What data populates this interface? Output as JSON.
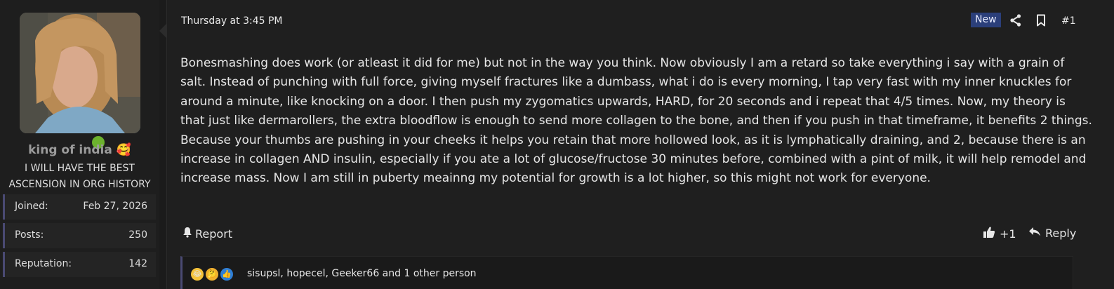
{
  "user": {
    "username": "king of india",
    "username_emoji": "🥰",
    "title_line1": "I WILL HAVE THE BEST",
    "title_line2": "ASCENSION IN ORG HISTORY",
    "online_color": "#6cb22d",
    "stats": [
      {
        "key": "Joined:",
        "value": "Feb 27, 2026"
      },
      {
        "key": "Posts:",
        "value": "250"
      },
      {
        "key": "Reputation:",
        "value": "142"
      }
    ]
  },
  "post": {
    "date": "Thursday at 3:45 PM",
    "badge": "New",
    "number": "#1",
    "body": "Bonesmashing does work (or atleast it did for me) but not in the way you think. Now obviously I am a retard so take everything i say with a grain of salt. Instead of punching with full force, giving myself fractures like a dumbass, what i do is every morning, I tap very fast with my inner knuckles for around a minute, like knocking on a door. I then push my zygomatics upwards, HARD, for 20 seconds and i repeat that 4/5 times. Now, my theory is that just like dermarollers, the extra bloodflow is enough to send more collagen to the bone, and then if you push in that timeframe, it benefits 2 things. Because your thumbs are pushing in your cheeks it helps you retain that more hollowed look, as it is lymphatically draining, and 2, because there is an increase in collagen AND insulin, especially if you ate a lot of glucose/fructose 30 minutes before, combined with a pint of milk, it will help remodel and increase mass. Now I am still in puberty meainng my potential for growth is a lot higher, so this might not work for everyone.",
    "report_label": "Report",
    "like_label": "+1",
    "reply_label": "Reply",
    "reactions": {
      "emojis": [
        "😂",
        "🤔",
        "👍"
      ],
      "names": "sisupsl, hopecel, Geeker66 and 1 other person"
    }
  },
  "icons": [
    "share-icon",
    "bookmark-icon",
    "bell-icon",
    "thumbs-up-icon",
    "reply-icon"
  ],
  "colors": {
    "badge_bg": "#2b3f7a",
    "accent_border": "#4a4a73"
  }
}
